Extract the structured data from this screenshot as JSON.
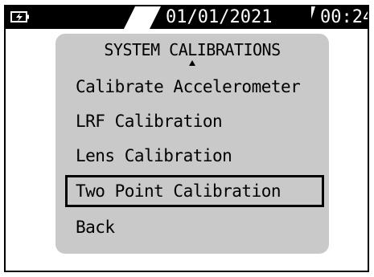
{
  "status_bar": {
    "battery_icon": "battery-charging-icon",
    "date": "01/01/2021",
    "time": "00:24"
  },
  "menu": {
    "title": "SYSTEM CALIBRATIONS",
    "scroll_indicator": "up-arrow-icon",
    "items": [
      {
        "label": "Calibrate Accelerometer",
        "selected": false
      },
      {
        "label": "LRF Calibration",
        "selected": false
      },
      {
        "label": "Lens Calibration",
        "selected": false
      },
      {
        "label": "Two Point Calibration",
        "selected": true
      },
      {
        "label": "Back",
        "selected": false
      }
    ]
  },
  "colors": {
    "background": "#ffffff",
    "status_bar": "#000000",
    "status_text": "#ffffff",
    "panel": "#c9c9c9",
    "text": "#000000"
  }
}
